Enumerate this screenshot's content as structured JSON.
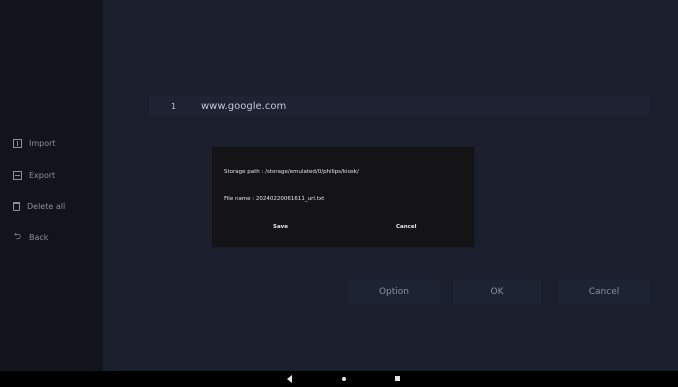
{
  "sidebar": {
    "items": [
      {
        "label": "Import",
        "icon": "import-icon"
      },
      {
        "label": "Export",
        "icon": "export-icon"
      },
      {
        "label": "Delete all",
        "icon": "trash-icon"
      },
      {
        "label": "Back",
        "icon": "back-arrow-icon"
      }
    ]
  },
  "list": {
    "rows": [
      {
        "index": "1",
        "url": "www.google.com"
      }
    ]
  },
  "actions": {
    "option_label": "Option",
    "ok_label": "OK",
    "cancel_label": "Cancel"
  },
  "dialog": {
    "storage_path": "Storage path : /storage/emulated/0/philips/kiosk/",
    "file_name": "File name : 20240220061611_url.txt",
    "save_label": "Save",
    "cancel_label": "Cancel"
  },
  "navbar": {
    "back_icon": "nav-back-icon",
    "home_icon": "nav-home-icon",
    "recents_icon": "nav-recents-icon"
  },
  "colors": {
    "background": "#0b0c10",
    "sidebar": "#11141a",
    "main_panel": "#1a1e2d",
    "dialog": "#141416",
    "button_bar": "#1e2334"
  }
}
